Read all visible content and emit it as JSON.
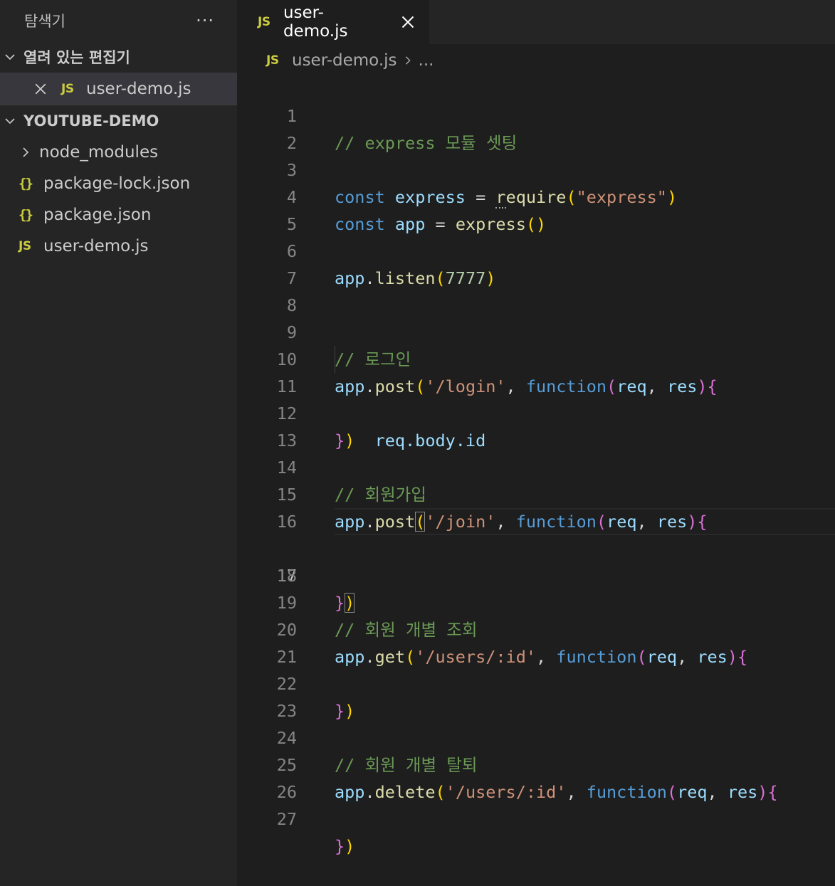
{
  "explorer": {
    "title": "탐색기",
    "more_label": "···",
    "open_editors": {
      "label": "열려 있는 편집기",
      "items": [
        {
          "icon": "JS",
          "name": "user-demo.js"
        }
      ]
    },
    "project": {
      "label": "YOUTUBE-DEMO",
      "items": [
        {
          "type": "folder",
          "icon": "chevron-right-icon",
          "name": "node_modules"
        },
        {
          "type": "file",
          "icon": "{}",
          "name": "package-lock.json"
        },
        {
          "type": "file",
          "icon": "{}",
          "name": "package.json"
        },
        {
          "type": "file",
          "icon": "JS",
          "name": "user-demo.js"
        }
      ]
    }
  },
  "editor": {
    "tab": {
      "icon": "JS",
      "label": "user-demo.js"
    },
    "breadcrumb": {
      "icon": "JS",
      "file": "user-demo.js",
      "rest": "..."
    },
    "active_line": 17,
    "line_numbers": [
      "1",
      "2",
      "3",
      "4",
      "5",
      "6",
      "7",
      "8",
      "9",
      "10",
      "11",
      "12",
      "13",
      "14",
      "15",
      "16",
      "17",
      "18",
      "19",
      "20",
      "21",
      "22",
      "23",
      "24",
      "25",
      "26",
      "27"
    ],
    "tokens": {
      "l1": "// express 모듈 셋팅",
      "l3_const": "const",
      "l3_express": "express",
      "l3_eq": " = ",
      "l3_require_r": "r",
      "l3_require_rest": "equire",
      "l3_open": "(",
      "l3_str": "\"express\"",
      "l3_close": ")",
      "l4_const": "const",
      "l4_app": "app",
      "l4_eq": " = ",
      "l4_express": "express",
      "l4_parens": "()",
      "l6_app": "app",
      "l6_dot": ".",
      "l6_listen": "listen",
      "l6_open": "(",
      "l6_num": "7777",
      "l6_close": ")",
      "l9": "// 로그인",
      "l10_app": "app",
      "l10_dot": ".",
      "l10_post": "post",
      "l10_open": "(",
      "l10_str": "'/login'",
      "l10_comma": ", ",
      "l10_function": "function",
      "l10_popen": "(",
      "l10_req": "req",
      "l10_comma2": ", ",
      "l10_res": "res",
      "l10_pclose": ")",
      "l10_brace": "{",
      "l11_indent": "    ",
      "l11_code": "req.body.id",
      "l12_brace": "}",
      "l12_paren": ")",
      "l14": "// 회원가입",
      "l15_app": "app",
      "l15_dot": ".",
      "l15_post": "post",
      "l15_open": "(",
      "l15_str": "'/join'",
      "l15_comma": ", ",
      "l15_function": "function",
      "l15_popen": "(",
      "l15_req": "req",
      "l15_comma2": ", ",
      "l15_res": "res",
      "l15_pclose": ")",
      "l15_brace": "{",
      "l17_brace": "}",
      "l17_paren": ")",
      "l19": "// 회원 개별 조회",
      "l20_app": "app",
      "l20_dot": ".",
      "l20_get": "get",
      "l20_open": "(",
      "l20_str": "'/users/:id'",
      "l20_comma": ", ",
      "l20_function": "function",
      "l20_popen": "(",
      "l20_req": "req",
      "l20_comma2": ", ",
      "l20_res": "res",
      "l20_pclose": ")",
      "l20_brace": "{",
      "l22_brace": "}",
      "l22_paren": ")",
      "l24": "// 회원 개별 탈퇴",
      "l25_app": "app",
      "l25_dot": ".",
      "l25_delete": "delete",
      "l25_open": "(",
      "l25_str": "'/users/:id'",
      "l25_comma": ", ",
      "l25_function": "function",
      "l25_popen": "(",
      "l25_req": "req",
      "l25_comma2": ", ",
      "l25_res": "res",
      "l25_pclose": ")",
      "l25_brace": "{",
      "l27_brace": "}",
      "l27_paren": ")"
    }
  },
  "colors": {
    "sidebar_bg": "#252526",
    "editor_bg": "#1e1e1e",
    "js_icon": "#cbcb41",
    "comment": "#6a9955",
    "keyword": "#569cd6",
    "variable": "#9cdcfe",
    "function": "#dcdcaa",
    "string": "#ce9178",
    "number": "#b5cea8"
  }
}
